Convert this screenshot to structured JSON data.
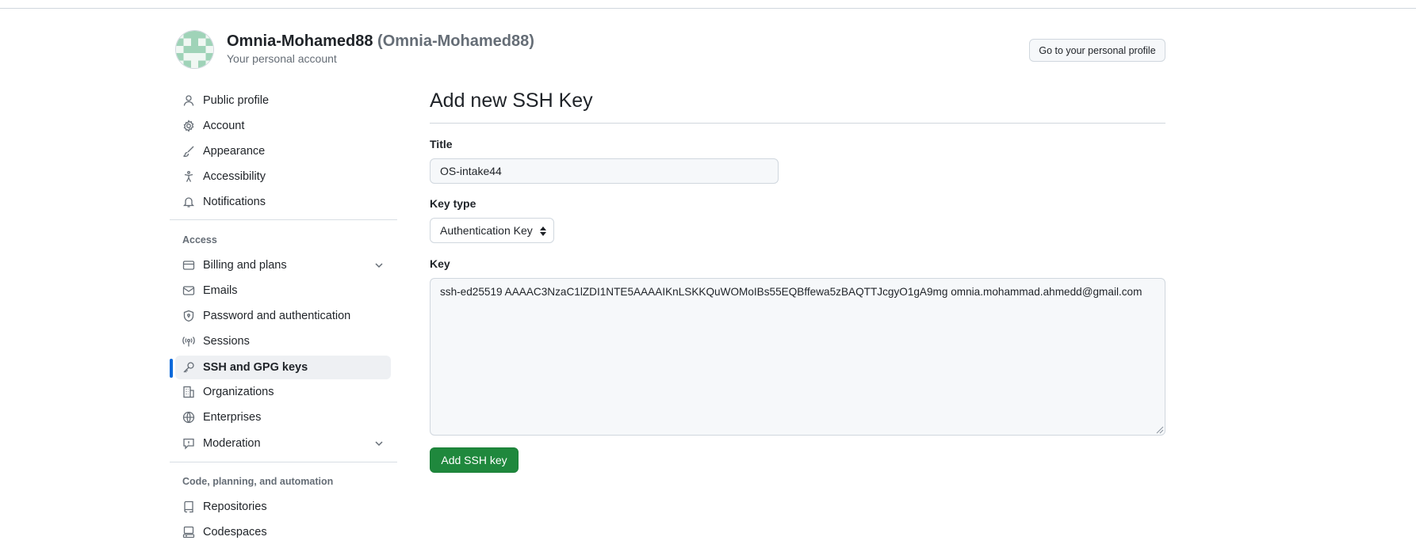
{
  "header": {
    "account_name": "Omnia-Mohamed88",
    "account_login": "(Omnia-Mohamed88)",
    "account_subtitle": "Your personal account",
    "profile_button": "Go to your personal profile"
  },
  "sidebar": {
    "items_top": [
      {
        "label": "Public profile",
        "icon": "person-icon"
      },
      {
        "label": "Account",
        "icon": "gear-icon"
      },
      {
        "label": "Appearance",
        "icon": "paintbrush-icon"
      },
      {
        "label": "Accessibility",
        "icon": "accessibility-icon"
      },
      {
        "label": "Notifications",
        "icon": "bell-icon"
      }
    ],
    "access_section_label": "Access",
    "items_access": [
      {
        "label": "Billing and plans",
        "icon": "credit-card-icon",
        "expandable": true
      },
      {
        "label": "Emails",
        "icon": "mail-icon"
      },
      {
        "label": "Password and authentication",
        "icon": "shield-lock-icon"
      },
      {
        "label": "Sessions",
        "icon": "broadcast-icon"
      },
      {
        "label": "SSH and GPG keys",
        "icon": "key-icon",
        "active": true
      },
      {
        "label": "Organizations",
        "icon": "organization-icon"
      },
      {
        "label": "Enterprises",
        "icon": "globe-icon"
      },
      {
        "label": "Moderation",
        "icon": "report-icon",
        "expandable": true
      }
    ],
    "code_section_label": "Code, planning, and automation",
    "items_code": [
      {
        "label": "Repositories",
        "icon": "repo-icon"
      },
      {
        "label": "Codespaces",
        "icon": "codespaces-icon"
      }
    ]
  },
  "main": {
    "page_title": "Add new SSH Key",
    "title_label": "Title",
    "title_value": "OS-intake44",
    "key_type_label": "Key type",
    "key_type_value": "Authentication Key",
    "key_label": "Key",
    "key_value": "ssh-ed25519 AAAAC3NzaC1lZDI1NTE5AAAAIKnLSKKQuWOMoIBs55EQBffewa5zBAQTTJcgyO1gA9mg omnia.mohammad.ahmedd@gmail.com",
    "submit_button": "Add SSH key"
  },
  "colors": {
    "primary_button": "#1f883d",
    "active_indicator": "#0969da",
    "muted_text": "#656d76",
    "border": "#d0d7de"
  }
}
